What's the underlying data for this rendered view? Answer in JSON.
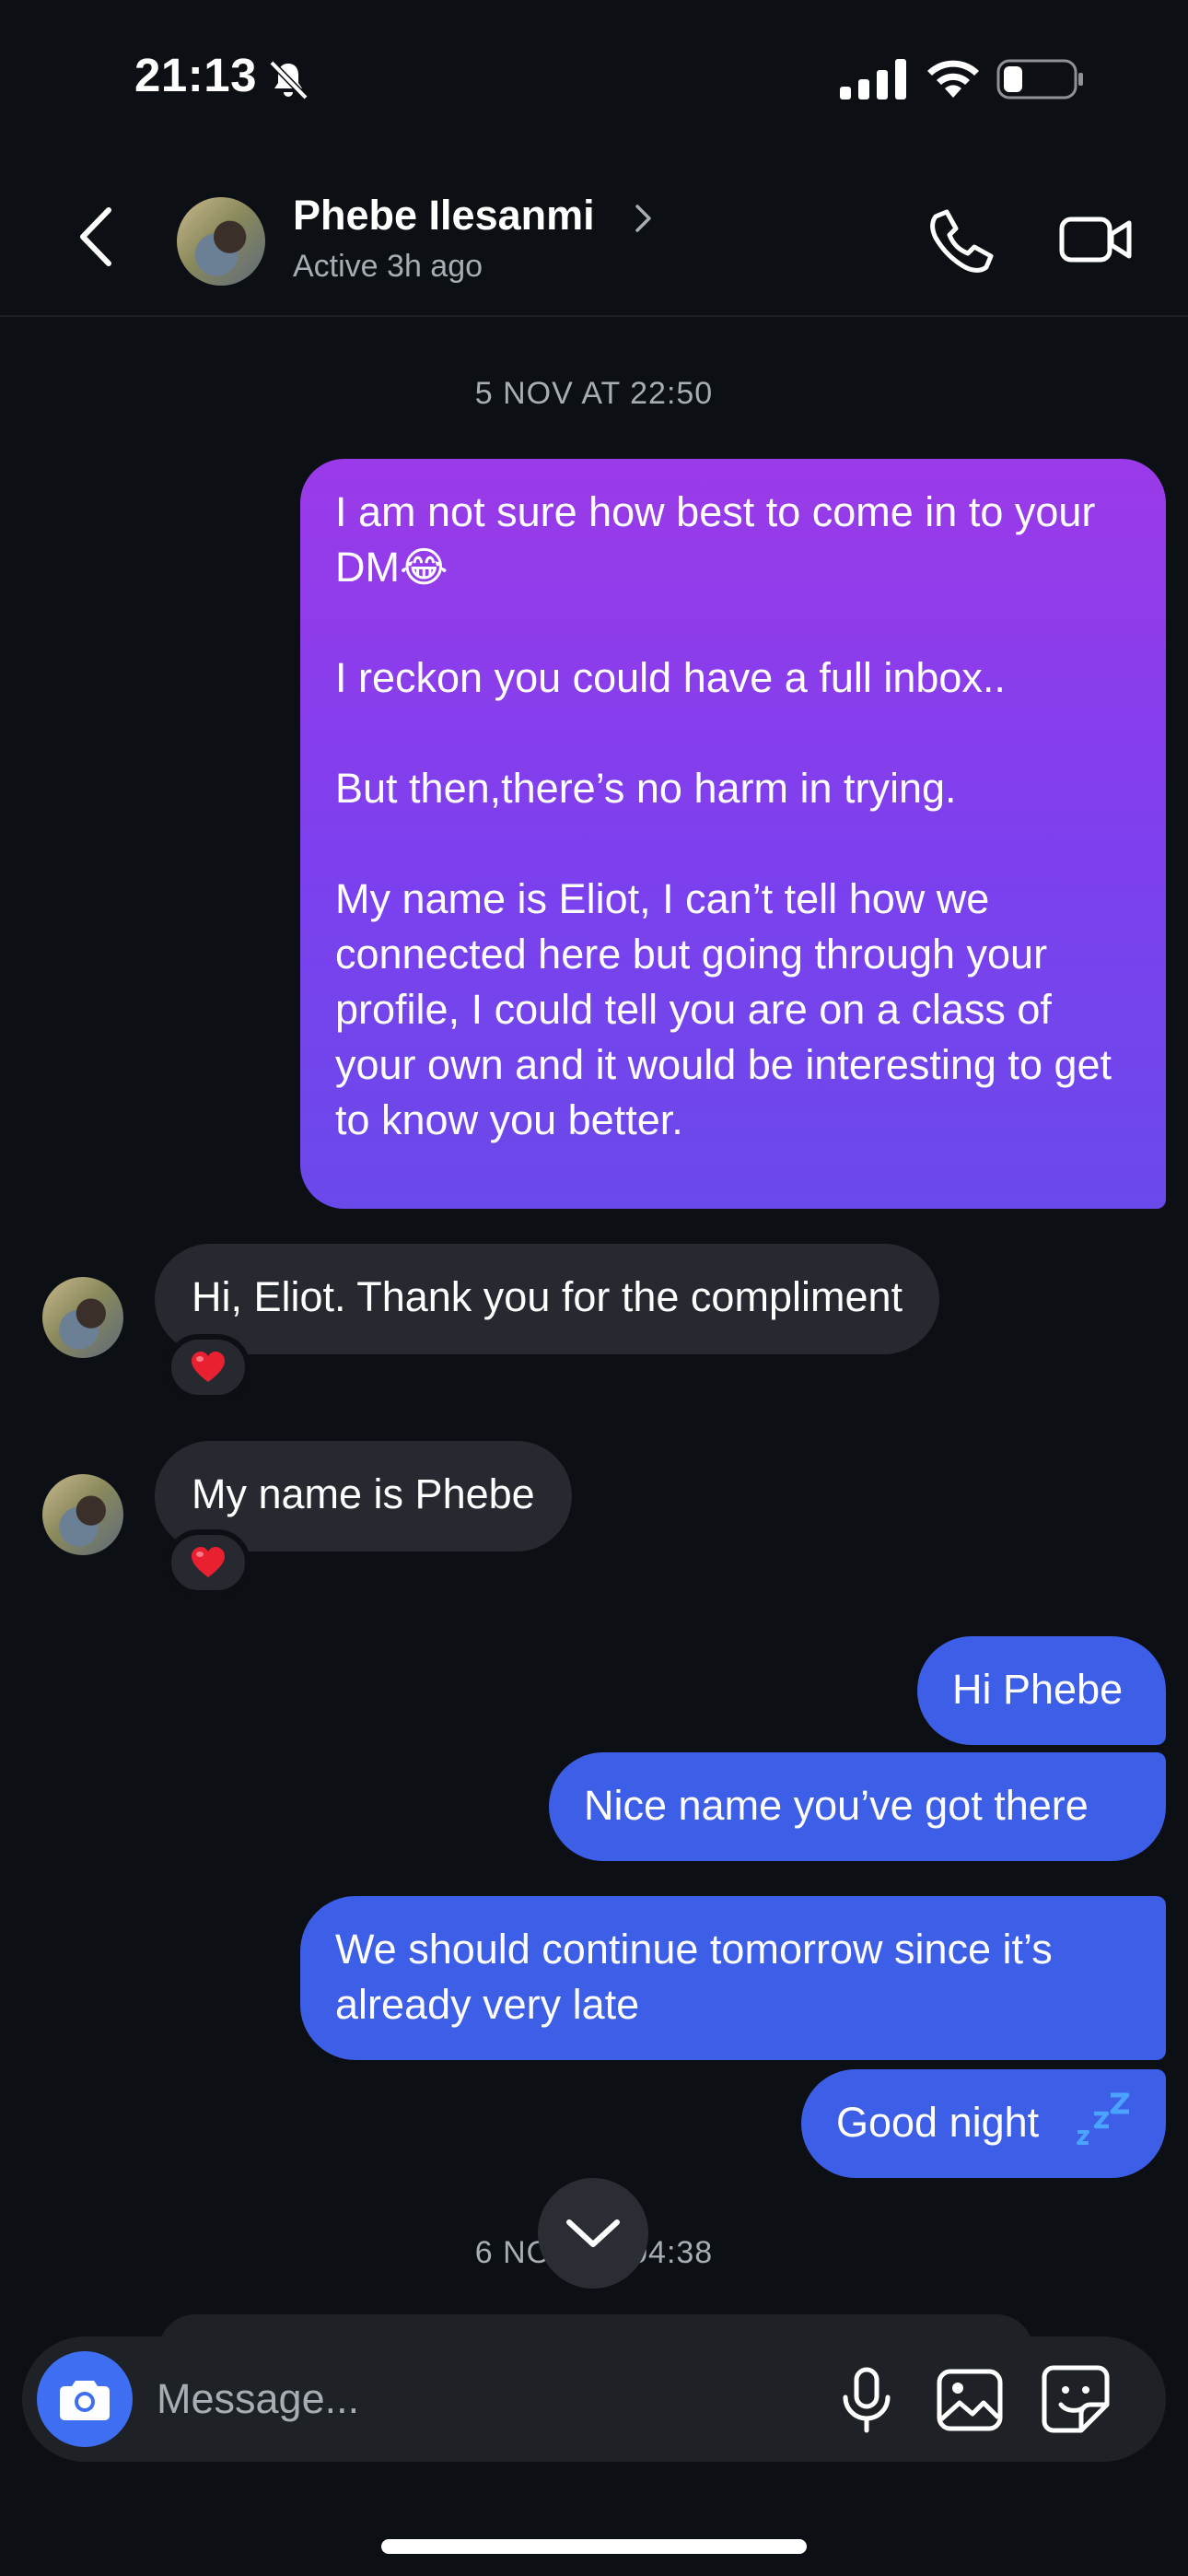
{
  "status_bar": {
    "time": "21:13"
  },
  "header": {
    "contact_name": "Phebe Ilesanmi",
    "contact_status": "Active 3h ago"
  },
  "conversation": {
    "timestamp_1": "5 NOV AT 22:50",
    "outgoing_1": "I am not sure how best to come in to your DM😂\n\nI reckon you could have a full inbox..\n\nBut then,there’s no harm in trying.\n\nMy name is Eliot, I can’t tell how we connected here but going through your profile, I could tell you are on a class of your own and it would be interesting to get to know you better.",
    "incoming_1": "Hi, Eliot. Thank you for the compliment",
    "incoming_2": "My name is Phebe",
    "reaction": "heart",
    "outgoing_2": "Hi Phebe",
    "outgoing_3": "Nice name you’ve got there",
    "outgoing_4": "We should continue tomorrow since it’s already very late",
    "outgoing_5": "Good night",
    "timestamp_2": "6 NOV AT 04:38"
  },
  "composer": {
    "placeholder": "Message..."
  },
  "colors": {
    "background": "#0c1014",
    "outgoing_bubble": "#3d5ee6",
    "outgoing_gradient_top": "#9b3ae8",
    "incoming_bubble": "#262a30",
    "camera_button": "#3e6ef2",
    "reaction_heart": "#e8202f"
  }
}
